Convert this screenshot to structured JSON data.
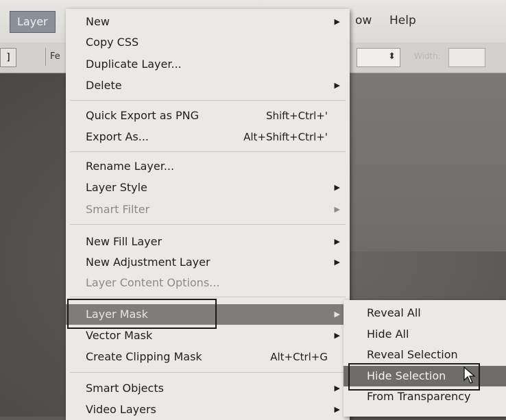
{
  "menubar": {
    "layer": "Layer",
    "view_fragment": "ow",
    "help": "Help"
  },
  "options_bar": {
    "left_glyph": "]",
    "feather_fragment": "Fe",
    "width_label": "Width:"
  },
  "layer_menu": {
    "items": [
      {
        "label": "New",
        "shortcut": "",
        "submenu": true,
        "disabled": false
      },
      {
        "label": "Copy CSS",
        "shortcut": "",
        "submenu": false,
        "disabled": false
      },
      {
        "label": "Duplicate Layer...",
        "shortcut": "",
        "submenu": false,
        "disabled": false
      },
      {
        "label": "Delete",
        "shortcut": "",
        "submenu": true,
        "disabled": false
      },
      {
        "label": "Quick Export as PNG",
        "shortcut": "Shift+Ctrl+'",
        "submenu": false,
        "disabled": false
      },
      {
        "label": "Export As...",
        "shortcut": "Alt+Shift+Ctrl+'",
        "submenu": false,
        "disabled": false
      },
      {
        "label": "Rename Layer...",
        "shortcut": "",
        "submenu": false,
        "disabled": false
      },
      {
        "label": "Layer Style",
        "shortcut": "",
        "submenu": true,
        "disabled": false
      },
      {
        "label": "Smart Filter",
        "shortcut": "",
        "submenu": true,
        "disabled": true
      },
      {
        "label": "New Fill Layer",
        "shortcut": "",
        "submenu": true,
        "disabled": false
      },
      {
        "label": "New Adjustment Layer",
        "shortcut": "",
        "submenu": true,
        "disabled": false
      },
      {
        "label": "Layer Content Options...",
        "shortcut": "",
        "submenu": false,
        "disabled": true
      },
      {
        "label": "Layer Mask",
        "shortcut": "",
        "submenu": true,
        "disabled": false,
        "highlighted": true
      },
      {
        "label": "Vector Mask",
        "shortcut": "",
        "submenu": true,
        "disabled": false
      },
      {
        "label": "Create Clipping Mask",
        "shortcut": "Alt+Ctrl+G",
        "submenu": false,
        "disabled": false
      },
      {
        "label": "Smart Objects",
        "shortcut": "",
        "submenu": true,
        "disabled": false
      },
      {
        "label": "Video Layers",
        "shortcut": "",
        "submenu": true,
        "disabled": false
      }
    ]
  },
  "mask_submenu": {
    "items": [
      {
        "label": "Reveal All"
      },
      {
        "label": "Hide All"
      },
      {
        "label": "Reveal Selection"
      },
      {
        "label": "Hide Selection",
        "highlighted": true
      },
      {
        "label": "From Transparency"
      }
    ]
  },
  "icons": {
    "submenu_arrow": "submenu-arrow-icon",
    "dropdown_arrow": "dropdown-arrow-icon",
    "cursor": "mouse-pointer-icon"
  },
  "colors": {
    "menu_bg": "#ebe9e6",
    "highlight_bg": "#7f7d7a",
    "menubar_bg": "#e3e1de"
  }
}
